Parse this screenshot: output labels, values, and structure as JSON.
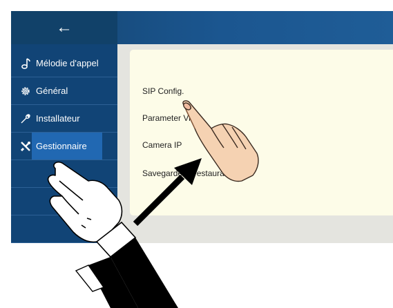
{
  "header": {
    "back_icon": "arrow-left-icon",
    "back_glyph": "←"
  },
  "sidebar": {
    "items": [
      {
        "label": "Mélodie d'appel",
        "icon": "music-note-icon"
      },
      {
        "label": "Général",
        "icon": "gear-icon"
      },
      {
        "label": "Installateur",
        "icon": "wrench-icon"
      },
      {
        "label": "Gestionnaire",
        "icon": "tools-icon",
        "active": true
      }
    ]
  },
  "panel": {
    "items": [
      {
        "label": "SIP Config."
      },
      {
        "label": "Parameter Vid"
      },
      {
        "label": "Camera IP"
      },
      {
        "label": "Savegarde et restauration"
      }
    ]
  },
  "colors": {
    "topbar": "#1b5690",
    "sidebar": "#114476",
    "active_item": "#2168b2",
    "panel_background": "#fdfce8",
    "device_background": "#e4e4df"
  }
}
